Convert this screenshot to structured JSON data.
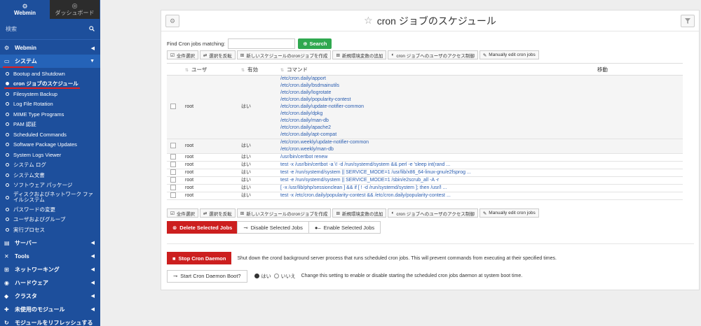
{
  "sidebar": {
    "tab_webmin": "Webmin",
    "tab_dashboard": "ダッシュボード",
    "search_placeholder": "検索",
    "cat_webmin": "Webmin",
    "cat_system": "システム",
    "system_items": [
      "Bootup and Shutdown",
      "cron ジョブのスケジュール",
      "Filesystem Backup",
      "Log File Rotation",
      "MIME Type Programs",
      "PAM 認証",
      "Scheduled Commands",
      "Software Package Updates",
      "System Logs Viewer",
      "システム ログ",
      "システム文書",
      "ソフトウェア パッケージ",
      "ディスクおよびネットワーク ファイルシステム",
      "パスワードの変更",
      "ユーザおよびグループ",
      "実行プロセス"
    ],
    "cat_servers": "サーバー",
    "cat_tools": "Tools",
    "cat_networking": "ネットワーキング",
    "cat_hardware": "ハードウェア",
    "cat_cluster": "クラスタ",
    "cat_unused": "未使用のモジュール",
    "refresh": "モジュールをリフレッシュする"
  },
  "page": {
    "title": "cron ジョブのスケジュール",
    "find_label": "Find Cron jobs matching:",
    "find_value": "",
    "search_button": "Search"
  },
  "toolbar": {
    "select_all": "全件選択",
    "invert": "選択を反転",
    "new_job": "新しいスケジュールのcronジョブを作成",
    "new_env": "新規環境変数の追加",
    "access": "cron ジョブへのユーザのアクセス制御",
    "manual": "Manually edit cron jobs"
  },
  "table": {
    "headers": {
      "user": "ユーザ",
      "active": "有効",
      "command": "コマンド",
      "move": "移動"
    },
    "rows": [
      {
        "user": "root",
        "active": "はい",
        "commands": [
          "/etc/cron.daily/apport",
          "/etc/cron.daily/bsdmainutils",
          "/etc/cron.daily/logrotate",
          "/etc/cron.daily/popularity-contest",
          "/etc/cron.daily/update-notifier-common",
          "/etc/cron.daily/dpkg",
          "/etc/cron.daily/man-db",
          "/etc/cron.daily/apache2",
          "/etc/cron.daily/apt-compat"
        ]
      },
      {
        "user": "root",
        "active": "はい",
        "commands": [
          "/etc/cron.weekly/update-notifier-common",
          "/etc/cron.weekly/man-db"
        ]
      },
      {
        "user": "root",
        "active": "はい",
        "commands": [
          "/usr/bin/certbot renew"
        ]
      },
      {
        "user": "root",
        "active": "はい",
        "commands": [
          "test -x /usr/bin/certbot -a \\! -d /run/systemd/system && perl -e 'sleep int(rand ..."
        ]
      },
      {
        "user": "root",
        "active": "はい",
        "commands": [
          "test -e /run/systemd/system || SERVICE_MODE=1 /usr/lib/x86_64-linux-gnu/e2fsprog ..."
        ]
      },
      {
        "user": "root",
        "active": "はい",
        "commands": [
          "test -e /run/systemd/system || SERVICE_MODE=1 /sbin/e2scrub_all -A -r"
        ]
      },
      {
        "user": "root",
        "active": "はい",
        "commands": [
          "[ -x /usr/lib/php/sessionclean ] && if [ ! -d /run/systemd/system ]; then /usr/l ..."
        ]
      },
      {
        "user": "root",
        "active": "はい",
        "commands": [
          "test -x /etc/cron.daily/popularity-contest && /etc/cron.daily/popularity-contest ..."
        ]
      }
    ]
  },
  "actions": {
    "delete": "Delete Selected Jobs",
    "disable": "Disable Selected Jobs",
    "enable": "Enable Selected Jobs"
  },
  "daemon": {
    "stop_button": "Stop Cron Daemon",
    "stop_desc": "Shut down the crond background server process that runs scheduled cron jobs. This will prevent commands from executing at their specified times.",
    "boot_button": "Start Cron Daemon Boot?",
    "yes": "はい",
    "no": "いいえ",
    "boot_desc": "Change this setting to enable or disable starting the scheduled cron jobs daemon at system boot time."
  },
  "colors": {
    "sidebar_bg": "#1d4f9c",
    "search_green": "#2fa84f",
    "danger_red": "#cc1f1f",
    "link_blue": "#2a5db0"
  }
}
